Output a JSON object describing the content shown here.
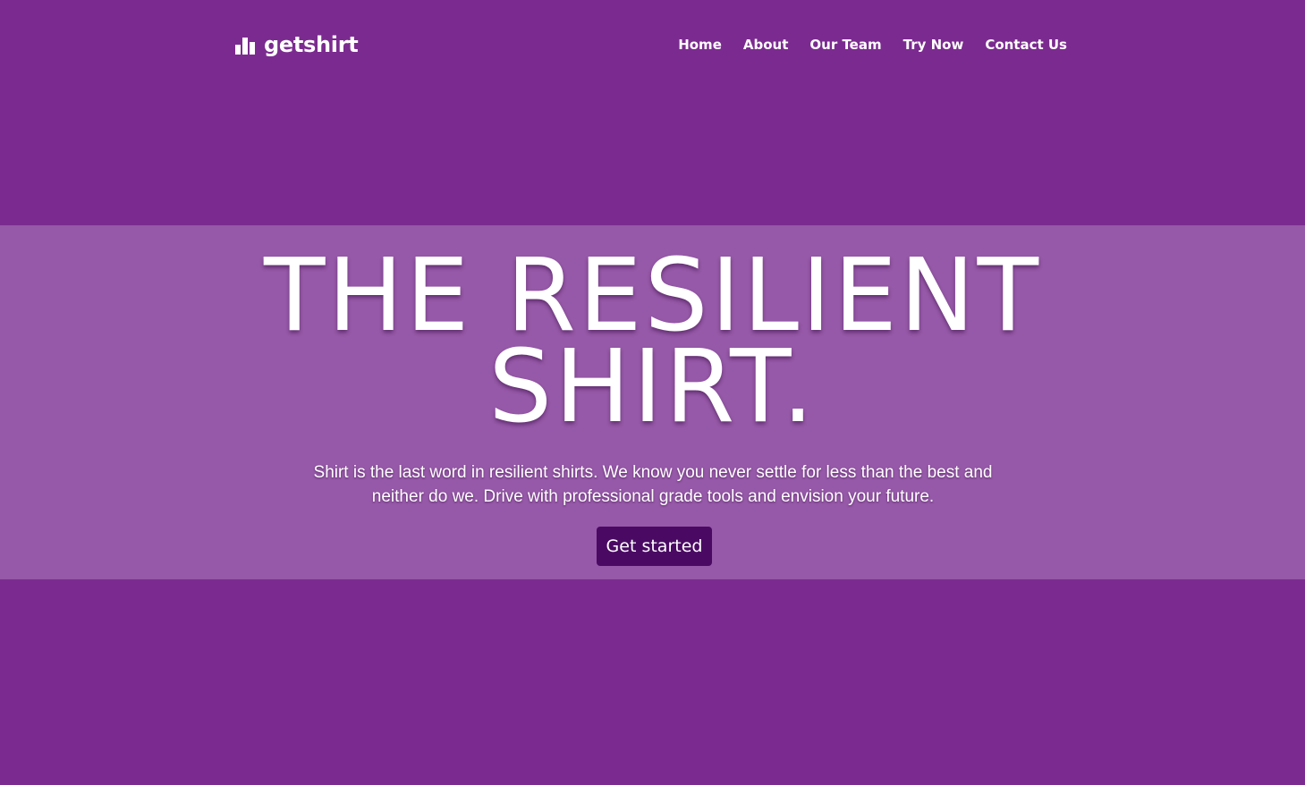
{
  "brand": {
    "name": "getshirt",
    "icon": "bar-chart-icon"
  },
  "nav": {
    "items": [
      {
        "label": "Home"
      },
      {
        "label": "About"
      },
      {
        "label": "Our Team"
      },
      {
        "label": "Try Now"
      },
      {
        "label": "Contact Us"
      }
    ]
  },
  "hero": {
    "headline_line1": "THE RESILIENT",
    "headline_line2": "SHIRT.",
    "subtitle": "Shirt is the last word in resilient shirts. We know you never settle for less than the best and neither do we. Drive with professional grade tools and envision your future.",
    "cta_label": "Get started"
  },
  "colors": {
    "background": "#7b2b8f",
    "band": "#9658a8",
    "button": "#4a0a63",
    "text": "#ffffff"
  }
}
